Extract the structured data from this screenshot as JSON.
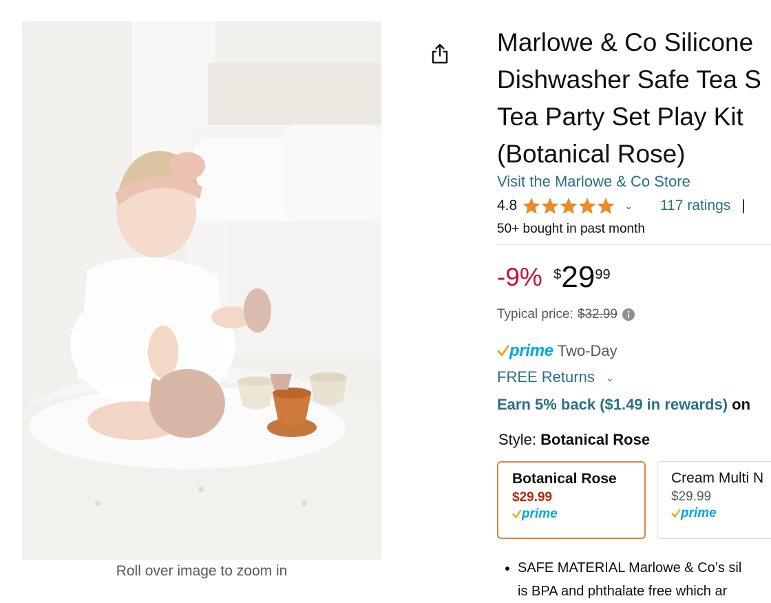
{
  "gallery": {
    "image_alt": "Toddler in a white dress playing with a pastel silicone tea set on a white bed",
    "zoom_hint": "Roll over image to zoom in"
  },
  "product": {
    "title_lines": [
      "Marlowe & Co Silicone",
      "Dishwasher Safe Tea S",
      "Tea Party Set Play Kit",
      "(Botanical Rose)"
    ],
    "store_link": "Visit the Marlowe & Co Store",
    "rating": "4.8",
    "ratings_count": "117 ratings",
    "separator": "|",
    "bought": "50+ bought in past month"
  },
  "price": {
    "discount": "-9%",
    "currency": "$",
    "whole": "29",
    "fraction": "99",
    "typical_label": "Typical price:",
    "typical_value": "$32.99"
  },
  "delivery": {
    "prime_label": "prime",
    "prime_sub": "Two-Day",
    "returns": "FREE Returns",
    "rewards_link": "Earn 5% back ($1.49 in rewards)",
    "rewards_rest": " on"
  },
  "style": {
    "label": "Style:",
    "selected": "Botanical Rose",
    "options": [
      {
        "name": "Botanical Rose",
        "price": "$29.99",
        "prime": "prime"
      },
      {
        "name": "Cream Multi N",
        "price": "$29.99",
        "prime": "prime"
      }
    ]
  },
  "bullets": [
    "SAFE MATERIAL Marlowe & Co’s sil",
    "is BPA and phthalate free which ar"
  ],
  "colors": {
    "link": "#2a6f83",
    "discount": "#cc0c39",
    "star": "#f08b24",
    "prime": "#00a8e1",
    "selected_border": "#e3833a",
    "selected_price": "#b12704"
  }
}
